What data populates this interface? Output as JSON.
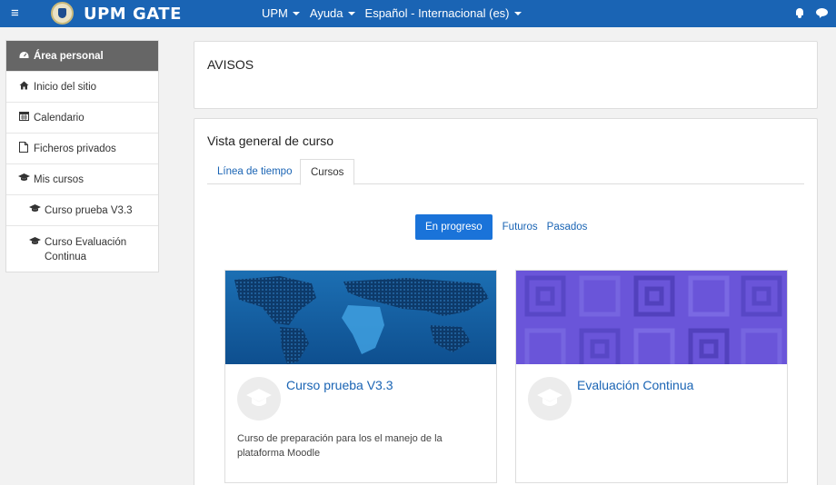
{
  "navbar": {
    "menu_icon": "hamburger-icon",
    "brand": "UPM GATE",
    "menus": [
      {
        "label": "UPM"
      },
      {
        "label": "Ayuda"
      },
      {
        "label": "Español - Internacional (es)"
      }
    ],
    "notifications_icon": "bell-icon",
    "messages_icon": "chat-bubble-icon",
    "colors": {
      "bar": "#1a64b4",
      "text": "#ffffff"
    }
  },
  "sidebar": {
    "items": [
      {
        "label": "Área personal",
        "icon": "dashboard-icon"
      },
      {
        "label": "Inicio del sitio",
        "icon": "home-icon"
      },
      {
        "label": "Calendario",
        "icon": "calendar-icon"
      },
      {
        "label": "Ficheros privados",
        "icon": "file-icon"
      },
      {
        "label": "Mis cursos",
        "icon": "graduation-cap-icon"
      },
      {
        "label": "Curso prueba V3.3",
        "icon": "graduation-cap-icon"
      },
      {
        "label": "Curso Evaluación Continua",
        "icon": "graduation-cap-icon"
      }
    ],
    "colors": {
      "active_bg": "#666666"
    }
  },
  "avisos": {
    "title": "AVISOS"
  },
  "overview": {
    "title": "Vista general de curso",
    "tabs": [
      {
        "label": "Línea de tiempo"
      },
      {
        "label": "Cursos"
      }
    ],
    "filters": [
      {
        "label": "En progreso"
      },
      {
        "label": "Futuros"
      },
      {
        "label": "Pasados"
      }
    ],
    "courses": [
      {
        "title": "Curso prueba V3.3",
        "description": "Curso de preparación para los el manejo de la plataforma Moodle",
        "image": "world-map-image"
      },
      {
        "title": "Evaluación Continua",
        "description": "",
        "image": "purple-squares-pattern"
      }
    ],
    "colors": {
      "link": "#1a64b4",
      "active_pill": "#1a73d9",
      "pattern": "#6a55d9"
    }
  }
}
